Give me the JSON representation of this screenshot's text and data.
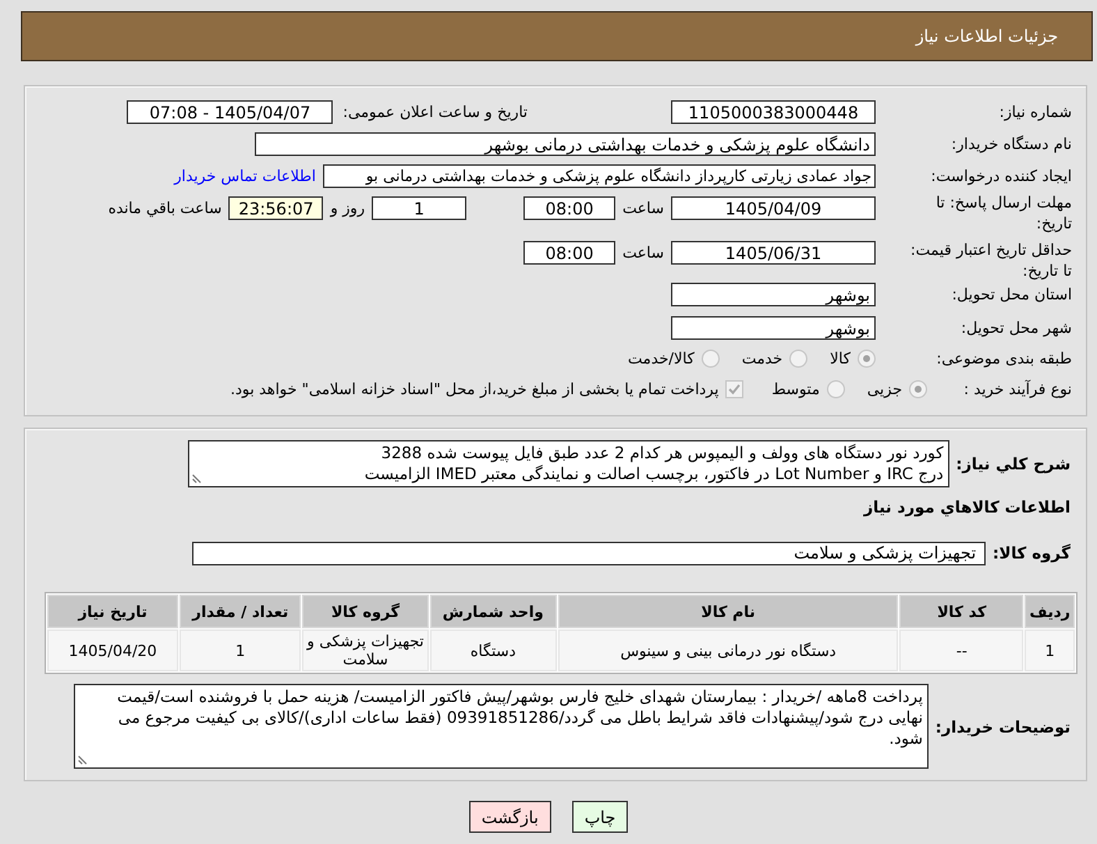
{
  "header": {
    "title": "جزئیات اطلاعات نیاز"
  },
  "details": {
    "need_number": {
      "label": "شماره نیاز:",
      "value": "1105000383000448"
    },
    "announce_datetime": {
      "label": "تاریخ و ساعت اعلان عمومی:",
      "value": "1405/04/07 - 07:08"
    },
    "buyer_org": {
      "label": "نام دستگاه خریدار:",
      "value": "دانشگاه علوم پزشکی و خدمات بهداشتی درمانی بوشهر"
    },
    "requester": {
      "label": "ایجاد کننده درخواست:",
      "value": "جواد عمادی زیارتی کارپرداز دانشگاه علوم پزشکی و خدمات بهداشتی درمانی بو",
      "contact_link": "اطلاعات تماس خریدار"
    },
    "reply_deadline": {
      "label": "مهلت ارسال پاسخ: تا تاریخ:",
      "date": "1405/04/09",
      "time_label": "ساعت",
      "time": "08:00",
      "days": "1",
      "days_label": "روز و",
      "remaining_time": "23:56:07",
      "remaining_label": "ساعت باقي مانده"
    },
    "price_validity": {
      "label": "حداقل تاریخ اعتبار قیمت: تا تاریخ:",
      "date": "1405/06/31",
      "time_label": "ساعت",
      "time": "08:00"
    },
    "delivery_province": {
      "label": "استان محل تحویل:",
      "value": "بوشهر"
    },
    "delivery_city": {
      "label": "شهر محل تحویل:",
      "value": "بوشهر"
    },
    "category": {
      "label": "طبقه بندی موضوعی:",
      "disabled": true,
      "options": [
        {
          "label": "کالا",
          "selected": true
        },
        {
          "label": "خدمت",
          "selected": false
        },
        {
          "label": "کالا/خدمت",
          "selected": false
        }
      ]
    },
    "purchase_process": {
      "label": "نوع فرآیند خرید :",
      "disabled": true,
      "options": [
        {
          "label": "جزیی",
          "selected": true
        },
        {
          "label": "متوسط",
          "selected": false
        }
      ],
      "treasury_option": {
        "label": "پرداخت تمام یا بخشی از مبلغ خرید،از محل \"اسناد خزانه اسلامی\" خواهد بود.",
        "checked": true,
        "disabled": true
      }
    }
  },
  "summary": {
    "label": "شرح کلي نیاز:",
    "value": "کورد نور دستگاه های وولف و الیمپوس هر کدام 2 عدد طبق فایل پیوست شده 3288\nدرج IRC و Lot Number در فاکتور، برچسب اصالت و نمایندگی معتبر IMED الزامیست"
  },
  "goods": {
    "title": "اطلاعات کالاهاي مورد نیاز",
    "group_label": "گروه کالا:",
    "group_value": "تجهیزات پزشکی و سلامت",
    "table": {
      "columns": [
        "ردیف",
        "کد کالا",
        "نام کالا",
        "واحد شمارش",
        "گروه کالا",
        "تعداد / مقدار",
        "تاریخ نیاز"
      ],
      "rows": [
        [
          "1",
          "--",
          "دستگاه نور درمانی بینی و سینوس",
          "دستگاه",
          "تجهیزات پزشکی و سلامت",
          "1",
          "1405/04/20"
        ]
      ]
    }
  },
  "buyer_notes": {
    "label": "توضیحات خریدار:",
    "value": "پرداخت 8ماهه /خریدار : بیمارستان شهدای خلیج فارس بوشهر/پیش فاکتور الزامیست/ هزینه حمل با فروشنده است/قیمت نهایی درج شود/پیشنهادات فاقد شرایط باطل می گردد/09391851286 (فقط ساعات اداری)/کالای بی کیفیت مرجوع می شود."
  },
  "buttons": [
    {
      "label": "چاپ",
      "kind": "print"
    },
    {
      "label": "بازگشت",
      "kind": "back"
    }
  ]
}
